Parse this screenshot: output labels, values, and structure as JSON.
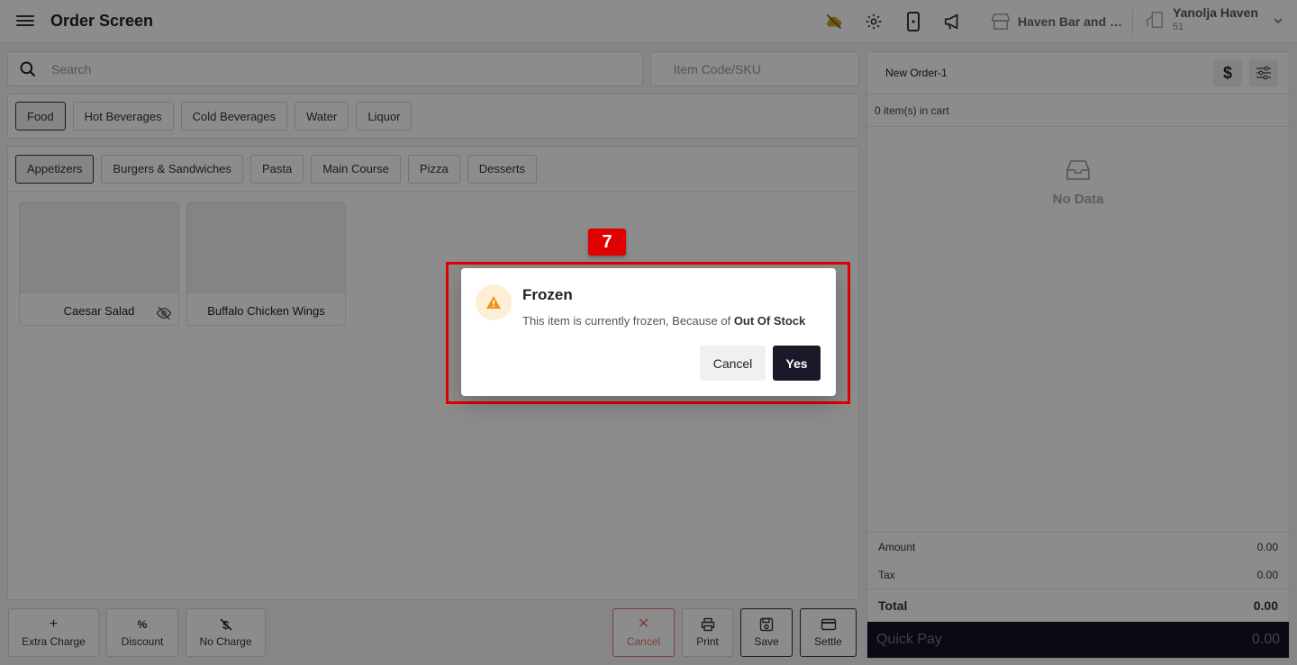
{
  "header": {
    "title": "Order Screen",
    "store_name": "Haven Bar and R...",
    "property_name": "Yanolja Haven",
    "property_id": "51"
  },
  "search": {
    "placeholder": "Search"
  },
  "sku": {
    "placeholder": "Item Code/SKU"
  },
  "categories": [
    "Food",
    "Hot Beverages",
    "Cold Beverages",
    "Water",
    "Liquor"
  ],
  "subcategories": [
    "Appetizers",
    "Burgers & Sandwiches",
    "Pasta",
    "Main Course",
    "Pizza",
    "Desserts"
  ],
  "items": [
    "Caesar Salad",
    "Buffalo Chicken Wings"
  ],
  "actions_left": [
    "Extra Charge",
    "Discount",
    "No Charge"
  ],
  "actions_right": [
    "Cancel",
    "Print",
    "Save",
    "Settle"
  ],
  "cart": {
    "order_name": "New Order-1",
    "count_text": "0 item(s) in cart",
    "empty_text": "No Data",
    "amount_label": "Amount",
    "amount_value": "0.00",
    "tax_label": "Tax",
    "tax_value": "0.00",
    "total_label": "Total",
    "total_value": "0.00",
    "quickpay_label": "Quick Pay",
    "quickpay_value": "0.00"
  },
  "dialog": {
    "step": "7",
    "title": "Frozen",
    "message_prefix": "This item is currently frozen, Because of ",
    "message_reason": "Out Of Stock",
    "cancel_label": "Cancel",
    "yes_label": "Yes"
  },
  "colors": {
    "accent": "#1b1929",
    "highlight": "#e00000",
    "warning": "#f0921e"
  }
}
